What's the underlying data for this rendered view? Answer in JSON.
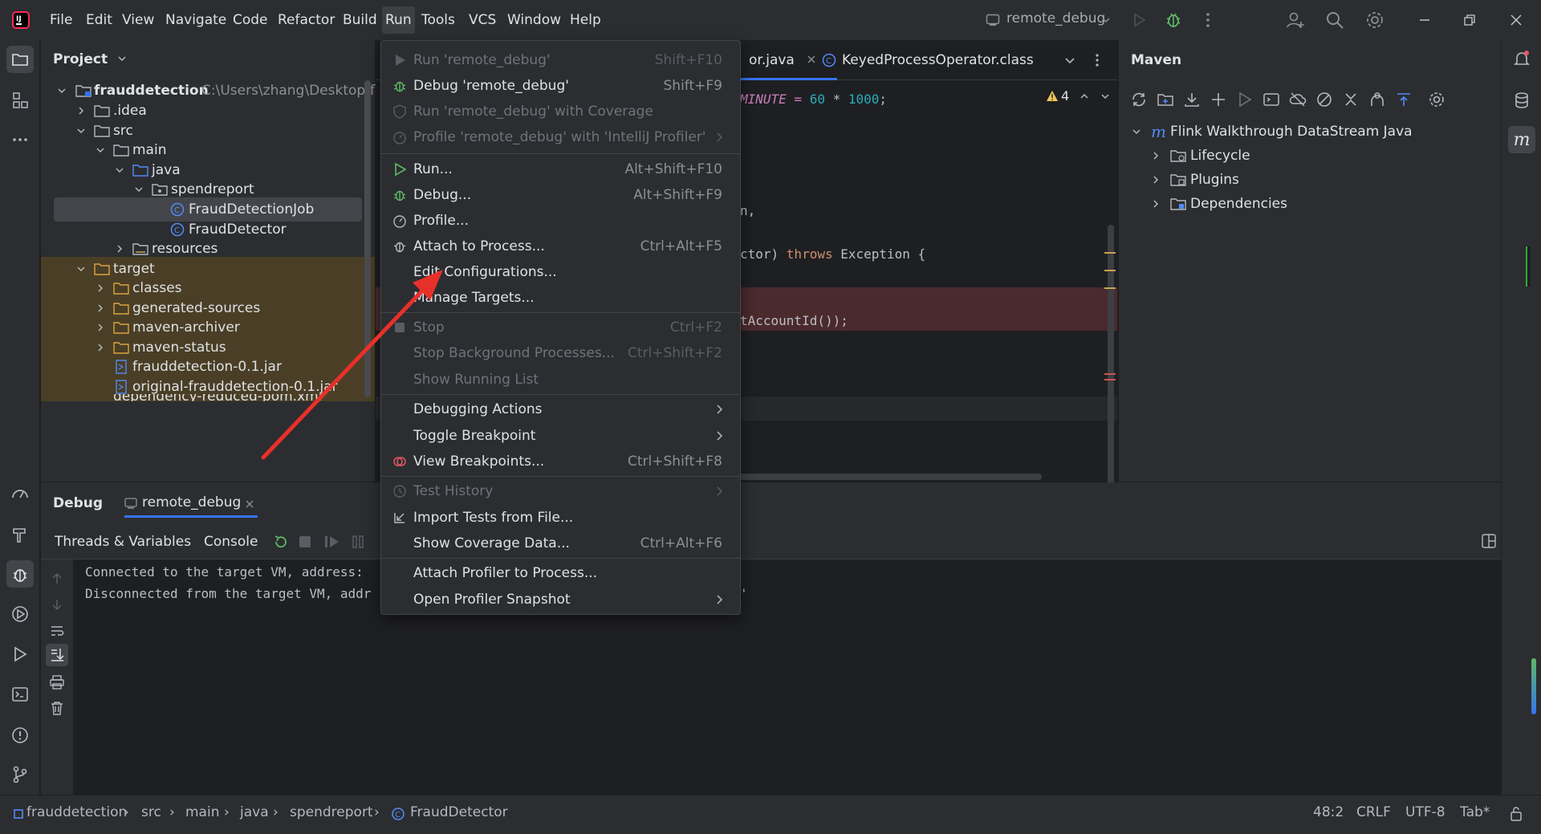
{
  "titlebar": {
    "menus": [
      "File",
      "Edit",
      "View",
      "Navigate",
      "Code",
      "Refactor",
      "Build",
      "Run",
      "Tools",
      "VCS",
      "Window",
      "Help"
    ],
    "run_config": "remote_debug"
  },
  "project": {
    "title": "Project",
    "rows": [
      {
        "label": "frauddetection",
        "extra": "C:\\Users\\zhang\\Desktop\\fli"
      },
      {
        "label": ".idea"
      },
      {
        "label": "src"
      },
      {
        "label": "main"
      },
      {
        "label": "java"
      },
      {
        "label": "spendreport"
      },
      {
        "label": "FraudDetectionJob"
      },
      {
        "label": "FraudDetector"
      },
      {
        "label": "resources"
      },
      {
        "label": "target"
      },
      {
        "label": "classes"
      },
      {
        "label": "generated-sources"
      },
      {
        "label": "maven-archiver"
      },
      {
        "label": "maven-status"
      },
      {
        "label": "frauddetection-0.1.jar"
      },
      {
        "label": "original-frauddetection-0.1.jar"
      },
      {
        "label": "dependency-reduced-pom.xml"
      }
    ]
  },
  "editor": {
    "tabs": [
      "or.java",
      "KeyedProcessOperator.class"
    ],
    "warnings": "4",
    "code": {
      "l1_a": "MINUTE = ",
      "l1_b": "60",
      "l1_c": " * ",
      "l1_d": "1000",
      "l1_e": ";",
      "l2": "n,",
      "l3_a": "ctor) ",
      "l3_b": "throws",
      "l3_c": " Exception {",
      "l4": "tAccountId());"
    }
  },
  "maven": {
    "title": "Maven",
    "root": "Flink Walkthrough DataStream Java",
    "children": [
      "Lifecycle",
      "Plugins",
      "Dependencies"
    ]
  },
  "debug": {
    "title": "Debug",
    "session": "remote_debug",
    "tabs": [
      "Threads & Variables",
      "Console"
    ],
    "console": [
      "Connected to the target VM, address: ",
      "Disconnected from the target VM, addr"
    ],
    "console_tail": "'"
  },
  "runmenu": {
    "items": [
      {
        "label": "Run 'remote_debug'",
        "shortcut": "Shift+F10",
        "disabled": true
      },
      {
        "label": "Debug 'remote_debug'",
        "shortcut": "Shift+F9"
      },
      {
        "label": "Run 'remote_debug' with Coverage",
        "disabled": true
      },
      {
        "label": "Profile 'remote_debug' with 'IntelliJ Profiler'",
        "disabled": true
      },
      {
        "label": "Run...",
        "shortcut": "Alt+Shift+F10"
      },
      {
        "label": "Debug...",
        "shortcut": "Alt+Shift+F9"
      },
      {
        "label": "Profile..."
      },
      {
        "label": "Attach to Process...",
        "shortcut": "Ctrl+Alt+F5"
      },
      {
        "label": "Edit Configurations..."
      },
      {
        "label": "Manage Targets..."
      },
      {
        "label": "Stop",
        "shortcut": "Ctrl+F2",
        "disabled": true
      },
      {
        "label": "Stop Background Processes...",
        "shortcut": "Ctrl+Shift+F2",
        "disabled": true
      },
      {
        "label": "Show Running List",
        "disabled": true
      },
      {
        "label": "Debugging Actions"
      },
      {
        "label": "Toggle Breakpoint"
      },
      {
        "label": "View Breakpoints...",
        "shortcut": "Ctrl+Shift+F8"
      },
      {
        "label": "Test History",
        "disabled": true
      },
      {
        "label": "Import Tests from File..."
      },
      {
        "label": "Show Coverage Data...",
        "shortcut": "Ctrl+Alt+F6"
      },
      {
        "label": "Attach Profiler to Process..."
      },
      {
        "label": "Open Profiler Snapshot"
      }
    ]
  },
  "status": {
    "breadcrumb": [
      "frauddetection",
      "src",
      "main",
      "java",
      "spendreport",
      "FraudDetector"
    ],
    "position": "48:2",
    "line_sep": "CRLF",
    "encoding": "UTF-8",
    "indent": "Tab*"
  },
  "colors": {
    "accent": "#3574f0",
    "annotation_arrow": "#e8302a",
    "breakpoint_line": "#4a2a2d",
    "target_folder_bg": "#4a3f26"
  }
}
